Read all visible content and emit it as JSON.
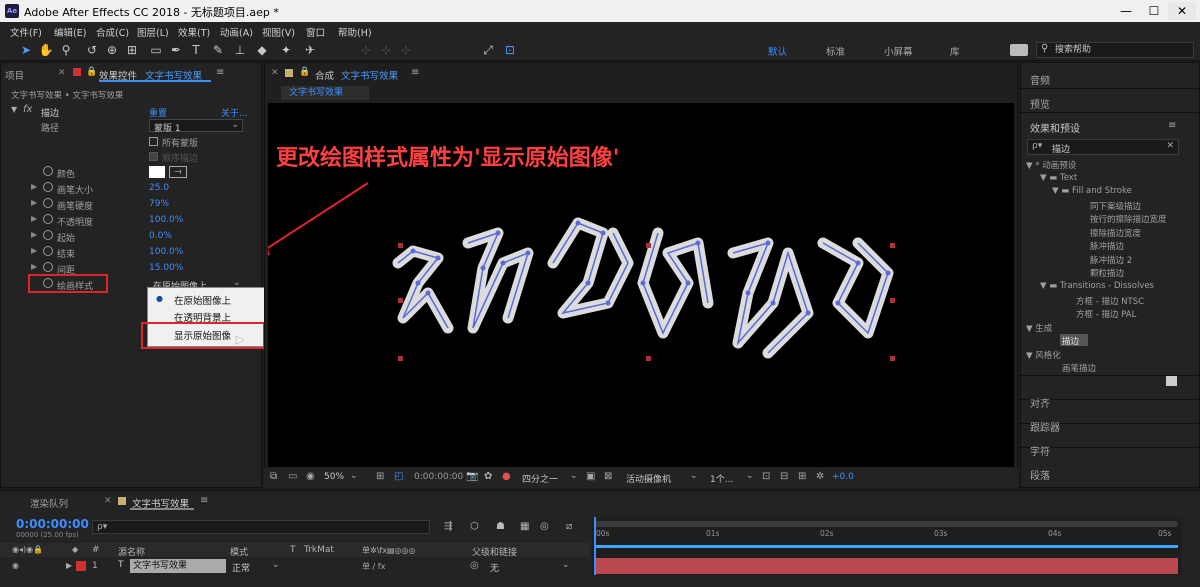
{
  "window": {
    "app_icon": "Ae",
    "title": "Adobe After Effects CC 2018 - 无标题项目.aep *",
    "minimize": "—",
    "maximize": "☐",
    "close": "✕"
  },
  "menu": [
    "文件(F)",
    "编辑(E)",
    "合成(C)",
    "图层(L)",
    "效果(T)",
    "动画(A)",
    "视图(V)",
    "窗口",
    "帮助(H)"
  ],
  "toolbar": {
    "align_label": "对齐",
    "workspaces": [
      "默认",
      "标准",
      "小屏幕",
      "库"
    ],
    "search_placeholder": "搜索帮助"
  },
  "left_panel": {
    "tab_project": "项目",
    "tab_effects_prefix": "效果控件",
    "tab_effects_name": "文字书写效果",
    "breadcrumb": "文字书写效果 • 文字书写效果",
    "effect_name": "描边",
    "reset": "重置",
    "about": "关于...",
    "path_label": "路径",
    "path_value": "蒙版 1",
    "all_masks": "所有蒙版",
    "sequential": "顺序描边",
    "color_label": "颜色",
    "params": [
      {
        "label": "画笔大小",
        "value": "25.0"
      },
      {
        "label": "画笔硬度",
        "value": "79%"
      },
      {
        "label": "不透明度",
        "value": "100.0%"
      },
      {
        "label": "起始",
        "value": "0.0%"
      },
      {
        "label": "结束",
        "value": "100.0%"
      },
      {
        "label": "间距",
        "value": "15.00%"
      }
    ],
    "paint_style_label": "绘画样式",
    "paint_style_value": "在原始图像上",
    "options": [
      "在原始图像上",
      "在透明背景上",
      "显示原始图像"
    ]
  },
  "comp": {
    "tab_prefix": "合成",
    "tab_name": "文字书写效果",
    "subtab": "文字书写效果",
    "annotation": "更改绘图样式属性为'显示原始图像'",
    "footer": {
      "zoom": "50%",
      "time": "0:00:00:00",
      "resolution": "四分之一",
      "camera": "活动摄像机",
      "views": "1个...",
      "exposure": "+0.0"
    }
  },
  "right_panel": {
    "top_items": [
      "音频",
      "预览"
    ],
    "fx_title": "效果和预设",
    "fx_search": "描边",
    "tree": [
      "▼ * 动画预设",
      "▼ ▬ Text",
      "▼ ▬ Fill and Stroke",
      "同下案级描边",
      "按行的擦除描边宽度",
      "擦除描边宽度",
      "脉冲描边",
      "脉冲描边 2",
      "颗粒描边",
      "▼ ▬ Transitions - Dissolves",
      "方框 - 描边 NTSC",
      "方框 - 描边 PAL",
      "▼ 生成",
      "描边",
      "▼ 风格化",
      "画笔描边"
    ],
    "bottom_items": [
      "对齐",
      "跟踪器",
      "字符",
      "段落"
    ]
  },
  "timeline": {
    "tab_render": "渲染队列",
    "tab_comp": "文字书写效果",
    "timecode": "0:00:00:00",
    "fps": "00000 (25.00 fps)",
    "search_placeholder": "ρ▾",
    "headers": {
      "num": "#",
      "source_name": "源名称",
      "mode": "模式",
      "t": "T",
      "trkmat": "TrkMat",
      "switches": "单✲\\fx▤◎◎◎",
      "parent": "父级和链接"
    },
    "layer": {
      "index": "1",
      "type": "T",
      "name": "文字书写效果",
      "mode": "正常",
      "switches": "单 ∕ fx",
      "parent": "无"
    },
    "ruler": [
      "00s",
      "01s",
      "02s",
      "03s",
      "04s",
      "05s"
    ]
  },
  "colors": {
    "accent": "#3d8eff",
    "red_box": "#e0242c",
    "layer_bar": "#b9484f",
    "work_area": "#3aa6ff"
  }
}
